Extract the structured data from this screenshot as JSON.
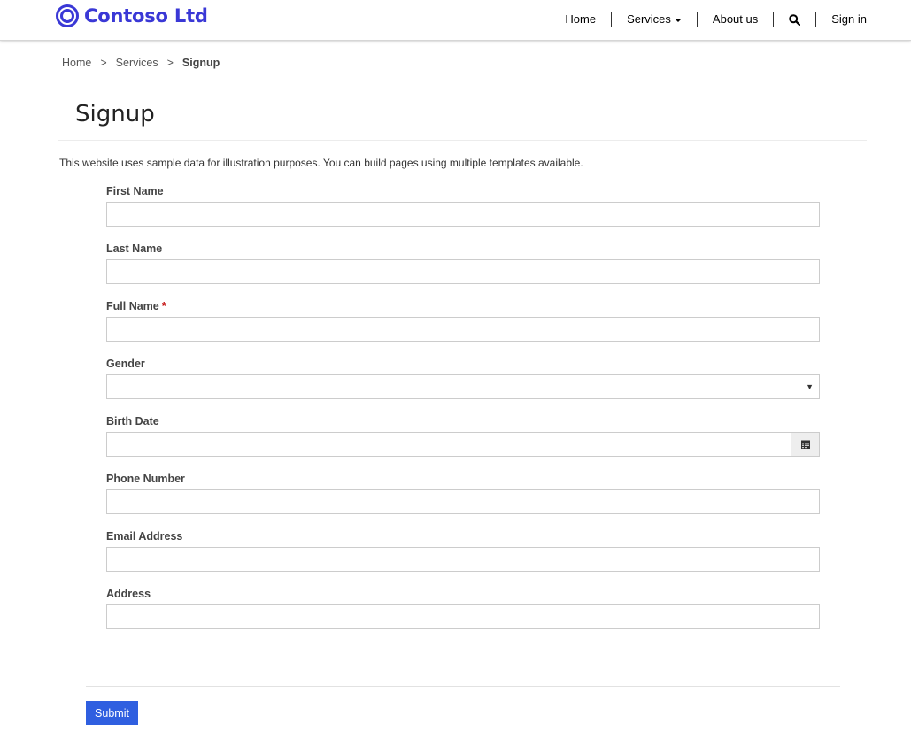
{
  "brand": {
    "name": "Contoso Ltd",
    "logo_icon": "ring-logo-icon",
    "color": "#3a38d6"
  },
  "nav": {
    "items": [
      {
        "label": "Home"
      },
      {
        "label": "Services",
        "has_dropdown": true
      },
      {
        "label": "About us"
      },
      {
        "icon": "search-icon"
      },
      {
        "label": "Sign in"
      }
    ]
  },
  "breadcrumb": {
    "home": "Home",
    "sep": ">",
    "services": "Services",
    "current": "Signup"
  },
  "page": {
    "title": "Signup",
    "intro": "This website uses sample data for illustration purposes. You can build pages using multiple templates available."
  },
  "form": {
    "first_name_label": "First Name",
    "last_name_label": "Last Name",
    "full_name_label": "Full Name",
    "required_mark": "*",
    "gender_label": "Gender",
    "gender_value": "",
    "select_arrow": "▼",
    "birth_date_label": "Birth Date",
    "calendar_icon": "calendar-icon",
    "phone_label": "Phone Number",
    "email_label": "Email Address",
    "address_label": "Address",
    "submit_label": "Submit"
  },
  "colors": {
    "accent": "#2f5fe0",
    "required": "#c00000"
  }
}
